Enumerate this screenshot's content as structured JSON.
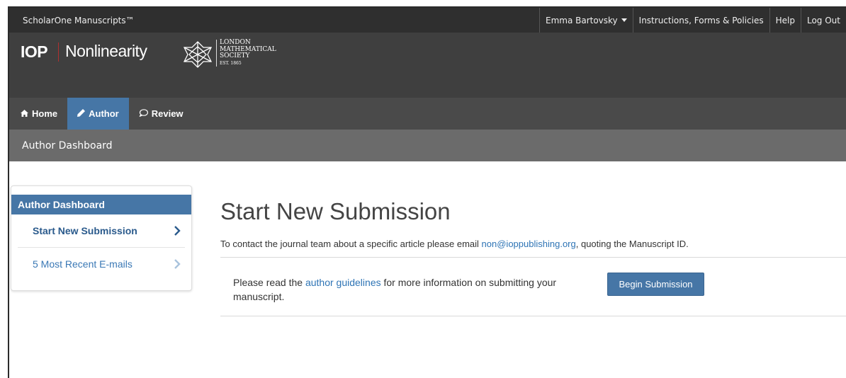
{
  "topbar": {
    "brand": "ScholarOne Manuscripts™",
    "user": "Emma Bartovsky",
    "instructions": "Instructions, Forms & Policies",
    "help": "Help",
    "logout": "Log Out"
  },
  "header": {
    "publisher": "IOP",
    "journal": "Nonlinearity",
    "society_lines": [
      "LONDON",
      "MATHEMATICAL",
      "SOCIETY",
      "EST. 1865"
    ]
  },
  "nav": {
    "home": "Home",
    "author": "Author",
    "review": "Review"
  },
  "breadcrumb": "Author Dashboard",
  "sidebar": {
    "title": "Author Dashboard",
    "items": [
      {
        "label": "Start New Submission"
      },
      {
        "label": "5 Most Recent E-mails"
      }
    ]
  },
  "main": {
    "title": "Start New Submission",
    "contact_prefix": "To contact the journal team about a specific article please email ",
    "contact_email": "non@ioppublishing.org",
    "contact_suffix": ", quoting the Manuscript ID.",
    "guide_prefix": "Please read the ",
    "guide_link": "author guidelines",
    "guide_suffix": " for more information on submitting your manuscript.",
    "begin_button": "Begin Submission"
  },
  "colors": {
    "accent": "#4676a6",
    "topbar": "#2f2f2f",
    "header": "#3f3f3f",
    "nav": "#4a4a4a",
    "breadcrumb": "#6b6b6b",
    "link": "#2e74b5"
  },
  "icons": {
    "home": "home-icon",
    "author": "pencil-icon",
    "review": "speech-bubble-icon",
    "user_menu": "caret-down-icon",
    "sidebar_item": "chevron-right-icon"
  }
}
